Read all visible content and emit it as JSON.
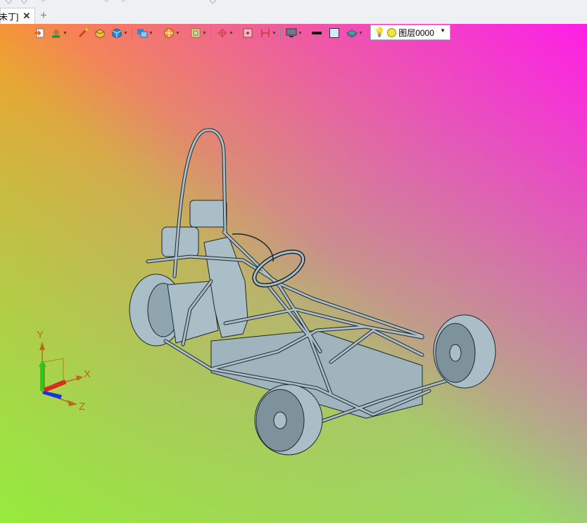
{
  "tab": {
    "label": "未丁]",
    "close_icon": "✕",
    "add_icon": "+"
  },
  "layer": {
    "value": "图层0000"
  },
  "toolbar": {
    "icons": [
      "import-icon",
      "paint-bucket-icon",
      "brush-icon",
      "shade-box-icon",
      "cube-icon",
      "view-cube-icon",
      "display-mode-icon",
      "wireframe-icon",
      "crosshair-icon",
      "render-icon",
      "section-icon",
      "monitor-icon",
      "line-color-icon",
      "face-color-icon",
      "layer-stack-icon"
    ]
  },
  "triad": {
    "x_label": "X",
    "y_label": "Y",
    "z_label": "Z"
  },
  "colors": {
    "model": "#a9bec7",
    "model_stroke": "#20282c",
    "axis_label": "#b96a1c",
    "grad_orange": "#ff962a",
    "grad_magenta": "#ff1ee6",
    "grad_green": "#96eb3c"
  }
}
